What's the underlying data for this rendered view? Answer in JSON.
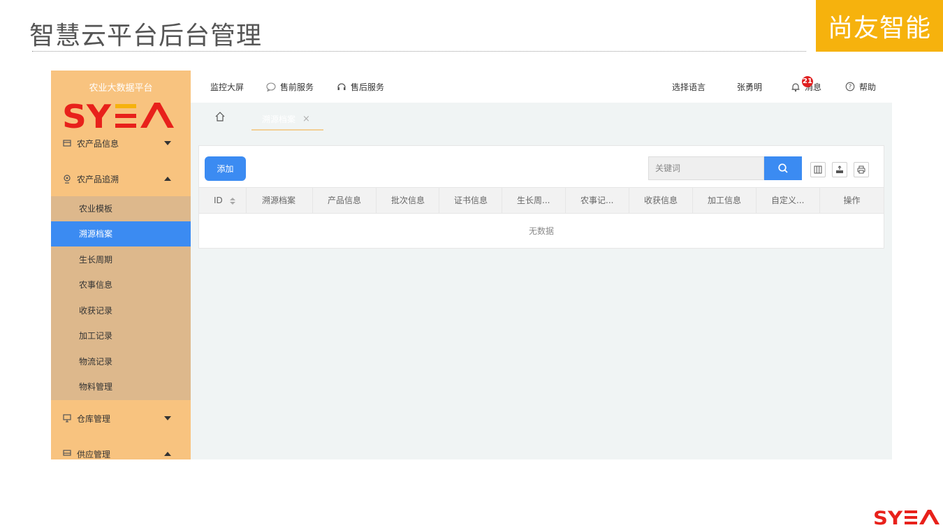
{
  "slide": {
    "title": "智慧云平台后台管理",
    "brand": "尚友智能",
    "logo_text": "SYEA"
  },
  "sidebar": {
    "platform_name": "农业大数据平台",
    "menus": [
      {
        "label": "农产品信息",
        "icon": "box-icon",
        "expanded": false
      },
      {
        "label": "农产品追溯",
        "icon": "location-pin-icon",
        "expanded": true
      },
      {
        "label": "仓库管理",
        "icon": "monitor-icon",
        "expanded": false
      },
      {
        "label": "供应管理",
        "icon": "monitor-icon",
        "expanded": true
      }
    ],
    "submenu": [
      {
        "label": "农业模板"
      },
      {
        "label": "溯源档案",
        "active": true
      },
      {
        "label": "生长周期"
      },
      {
        "label": "农事信息"
      },
      {
        "label": "收获记录"
      },
      {
        "label": "加工记录"
      },
      {
        "label": "物流记录"
      },
      {
        "label": "物料管理"
      }
    ],
    "active_color": "#3b8bf2",
    "bg_color": "#f8c37f"
  },
  "topnav": {
    "monitor": "监控大屏",
    "presale": "售前服务",
    "aftersale": "售后服务",
    "language": "选择语言",
    "user": "张勇明",
    "messages": "消息",
    "message_count": "21",
    "help": "帮助"
  },
  "tabs": {
    "active_label": "溯源档案",
    "close": "×"
  },
  "toolbar": {
    "add_label": "添加",
    "search_placeholder": "关键词"
  },
  "table": {
    "columns": [
      "ID",
      "溯源档案",
      "产品信息",
      "批次信息",
      "证书信息",
      "生长周...",
      "农事记...",
      "收获信息",
      "加工信息",
      "自定义...",
      "操作"
    ],
    "empty_text": "无数据"
  }
}
